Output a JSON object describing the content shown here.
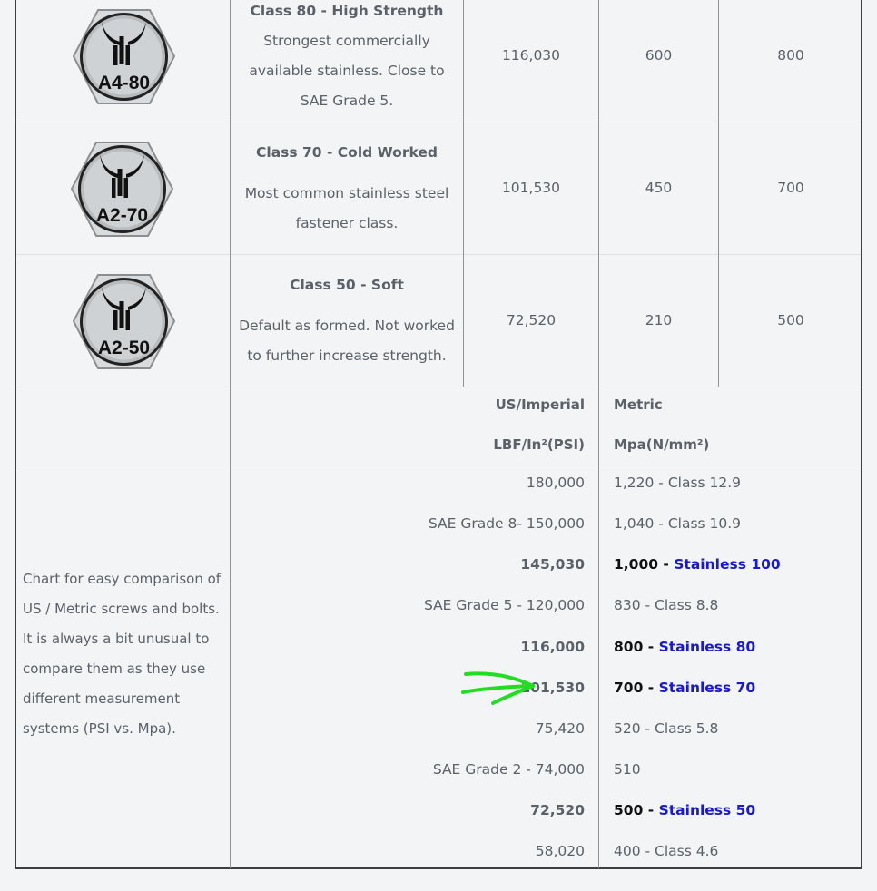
{
  "classes": [
    {
      "badge": "A4-80",
      "title": "Class 80 - High Strength",
      "desc": "Strongest commercially available stainless. Close to SAE Grade 5.",
      "psi": "116,030",
      "yield": "600",
      "tensile": "800"
    },
    {
      "badge": "A2-70",
      "title": "Class 70 - Cold Worked",
      "desc": "Most common stainless steel fastener class.",
      "psi": "101,530",
      "yield": "450",
      "tensile": "700"
    },
    {
      "badge": "A2-50",
      "title": "Class 50 - Soft",
      "desc": "Default as formed. Not worked to further increase strength.",
      "psi": "72,520",
      "yield": "210",
      "tensile": "500"
    }
  ],
  "comparison": {
    "header_us": "US/Imperial",
    "header_metric": "Metric",
    "unit_us": "LBF/In²(PSI)",
    "unit_metric": "Mpa(N/mm²)",
    "note": "Chart for easy comparison of US / Metric screws and bolts.  It is always a bit unusual to compare them as they use different measurement systems (PSI vs. Mpa).",
    "rows": [
      {
        "psi": "180,000",
        "mpa": "1,220 - Class 12.9"
      },
      {
        "psi": "SAE Grade 8- 150,000",
        "mpa": "1,040 - Class 10.9"
      },
      {
        "psi": "145,030",
        "mpa_value": "1,000 - ",
        "mpa_link": "Stainless 100"
      },
      {
        "psi": "SAE Grade 5 - 120,000",
        "mpa": "830 - Class 8.8"
      },
      {
        "psi": "116,000",
        "mpa_value": "800 - ",
        "mpa_link": "Stainless 80"
      },
      {
        "psi": "101,530",
        "mpa_value": "700 - ",
        "mpa_link": "Stainless 70"
      },
      {
        "psi": "75,420",
        "mpa": "520 - Class 5.8"
      },
      {
        "psi": "SAE Grade 2 - 74,000",
        "mpa": "510"
      },
      {
        "psi": "72,520",
        "mpa_value": "500 - ",
        "mpa_link": "Stainless 50"
      },
      {
        "psi": "58,020",
        "mpa": "400 - Class 4.6"
      }
    ]
  },
  "colors": {
    "link": "#1a1acc",
    "arrow": "#22dd22"
  }
}
